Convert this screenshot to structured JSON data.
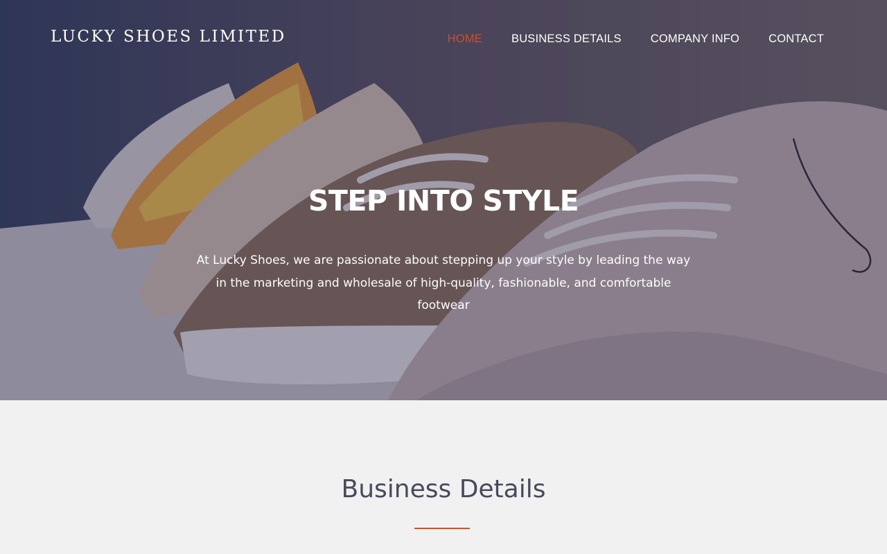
{
  "header": {
    "brand": "LUCKY SHOES LIMITED",
    "nav": [
      {
        "label": "HOME",
        "active": true
      },
      {
        "label": "BUSINESS DETAILS",
        "active": false
      },
      {
        "label": "COMPANY INFO",
        "active": false
      },
      {
        "label": "CONTACT",
        "active": false
      }
    ]
  },
  "hero": {
    "title": "STEP INTO STYLE",
    "text": "At Lucky Shoes, we are passionate about stepping up your style by leading the way in the marketing and wholesale of high-quality, fashionable, and comfortable footwear"
  },
  "section": {
    "title": "Business Details"
  },
  "colors": {
    "accent": "#c8502a",
    "hero_overlay": "#30304e",
    "page_background": "#f1f1f2",
    "heading_text": "#474a59"
  }
}
